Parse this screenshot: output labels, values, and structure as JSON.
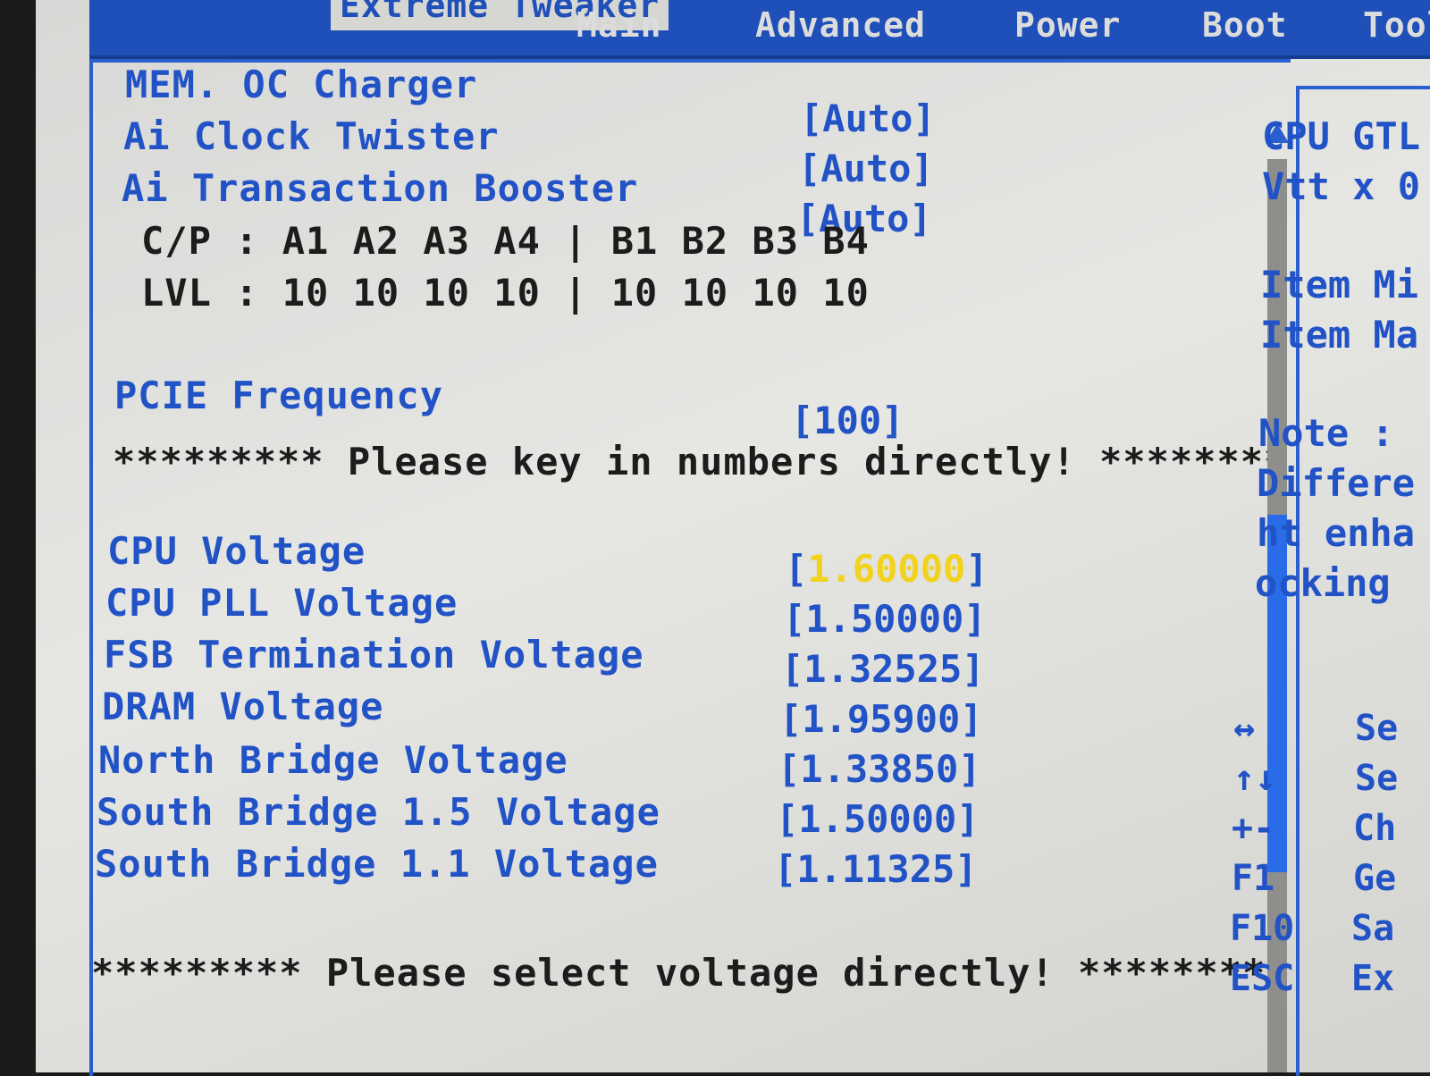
{
  "menu": {
    "tabs": [
      {
        "label": "Extreme Tweaker",
        "active": true
      },
      {
        "label": "Main",
        "active": false
      },
      {
        "label": "Advanced",
        "active": false
      },
      {
        "label": "Power",
        "active": false
      },
      {
        "label": "Boot",
        "active": false
      },
      {
        "label": "Tools",
        "active": false
      }
    ]
  },
  "settings": {
    "mem_oc_charger": {
      "label": "MEM. OC Charger",
      "value": ""
    },
    "ai_clock_twister": {
      "label": "Ai Clock Twister",
      "value": "[Auto]"
    },
    "ai_transaction_booster": {
      "label": "Ai Transaction Booster",
      "value": "[Auto]"
    },
    "mem_oc_value": "[Auto]",
    "cp_row": "C/P : A1 A2 A3 A4 | B1 B2 B3 B4",
    "lvl_row": "LVL : 10 10 10 10 | 10 10 10 10",
    "pcie_frequency": {
      "label": "PCIE Frequency",
      "value": "[100]"
    },
    "notice_numbers": "********* Please key in numbers directly! ********",
    "cpu_voltage": {
      "label": "CPU Voltage",
      "bracket_open": "[",
      "value": "1.60000",
      "bracket_close": "]"
    },
    "cpu_pll_voltage": {
      "label": "CPU PLL Voltage",
      "value": "[1.50000]"
    },
    "fsb_termination_voltage": {
      "label": "FSB Termination Voltage",
      "value": "[1.32525]"
    },
    "dram_voltage": {
      "label": "DRAM Voltage",
      "value": "[1.95900]"
    },
    "north_bridge_voltage": {
      "label": "North Bridge Voltage",
      "value": "[1.33850]"
    },
    "south_bridge_15_voltage": {
      "label": "South Bridge 1.5 Voltage",
      "value": "[1.50000]"
    },
    "south_bridge_11_voltage": {
      "label": "South Bridge 1.1 Voltage",
      "value": "[1.11325]"
    },
    "notice_voltage": "********* Please select voltage directly! ********"
  },
  "help_panel": {
    "line1": "CPU GTL",
    "line2": "Vtt x 0",
    "item_min": "Item Mi",
    "item_max": "Item Ma",
    "note": "Note :",
    "note_l1": "Differe",
    "note_l2": "ht enha",
    "note_l3": "ocking"
  },
  "keys": [
    {
      "key": "↔",
      "desc": "Se"
    },
    {
      "key": "↑↓",
      "desc": "Se"
    },
    {
      "key": "+-",
      "desc": "Ch"
    },
    {
      "key": "F1",
      "desc": "Ge"
    },
    {
      "key": "F10",
      "desc": "Sa"
    },
    {
      "key": "ESC",
      "desc": "Ex"
    }
  ],
  "colors": {
    "label_blue": "#2152c6",
    "selected_yellow": "#f2d21d",
    "menubar_blue": "#1f4fb8",
    "background": "#dedede"
  }
}
